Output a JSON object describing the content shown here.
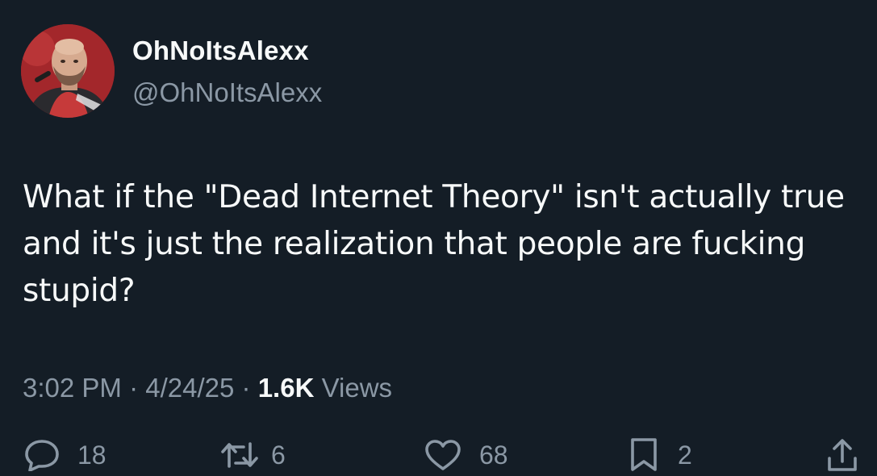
{
  "author": {
    "display_name": "OhNoItsAlexx",
    "handle": "@OhNoItsAlexx",
    "avatar": "profile-photo"
  },
  "tweet": {
    "text": "What if the \"Dead Internet Theory\" isn't actually true and it's just the realization that people are fucking stupid?",
    "time": "3:02 PM",
    "separator1": "·",
    "date": "4/24/25",
    "separator2": "·",
    "views_count": "1.6K",
    "views_label": "Views"
  },
  "actions": {
    "replies": "18",
    "reposts": "6",
    "likes": "68",
    "bookmarks": "2"
  },
  "icons": {
    "reply": "reply-icon",
    "repost": "repost-icon",
    "like": "heart-icon",
    "bookmark": "bookmark-icon",
    "share": "share-icon"
  },
  "colors": {
    "background": "#141d26",
    "primary_text": "#f7f9f9",
    "secondary_text": "#8b98a5"
  }
}
